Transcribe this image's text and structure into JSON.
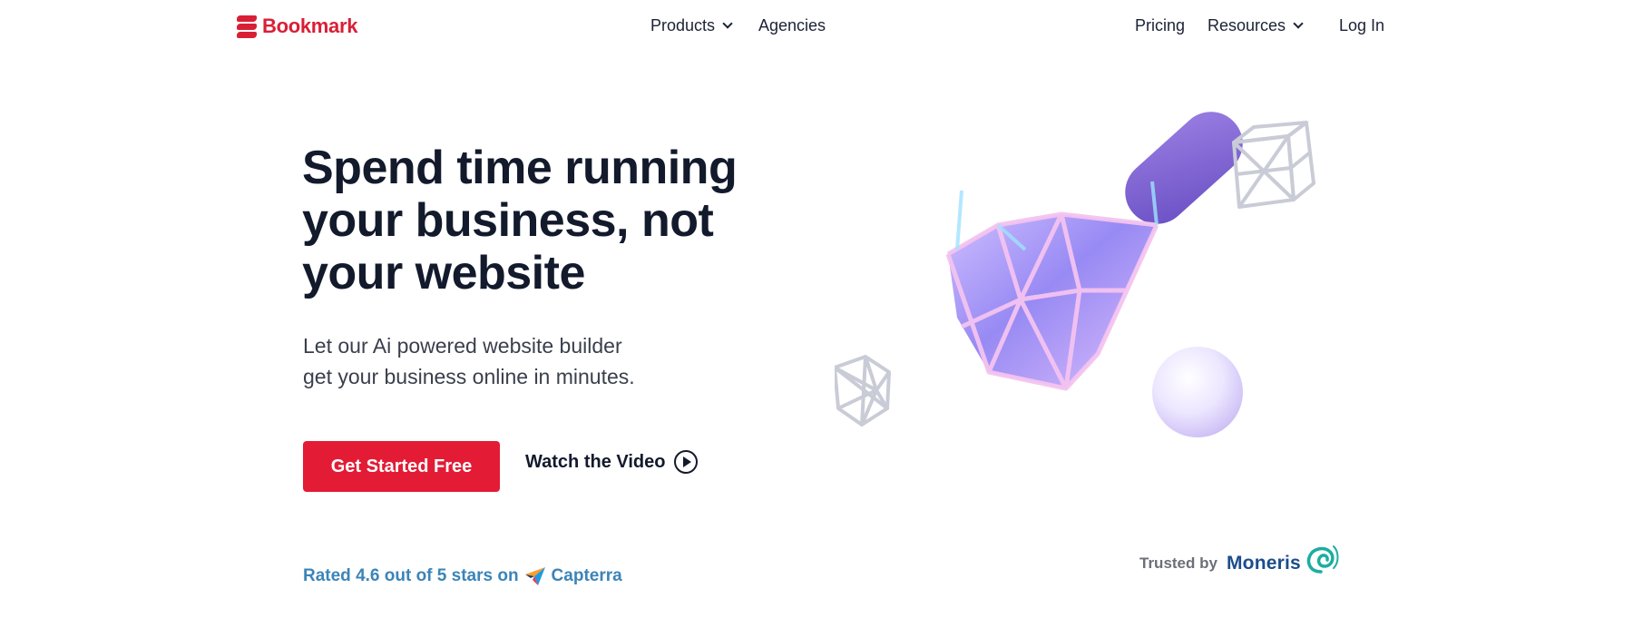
{
  "brand": {
    "name": "Bookmark",
    "color": "#d91f36"
  },
  "nav": {
    "products": "Products",
    "agencies": "Agencies",
    "pricing": "Pricing",
    "resources": "Resources",
    "login": "Log In"
  },
  "hero": {
    "headline_line1": "Spend time running",
    "headline_line2": "your business, not",
    "headline_line3": "your website",
    "sub_line1": "Let our Ai powered website builder",
    "sub_line2": "get your business online in minutes.",
    "cta_primary": "Get Started Free",
    "cta_video": "Watch the Video"
  },
  "rating": {
    "text": "Rated 4.6 out of 5 stars on",
    "platform": "Capterra"
  },
  "trusted": {
    "label": "Trusted by",
    "partner": "Moneris"
  },
  "colors": {
    "accent_red": "#e31b34",
    "rating_blue": "#3b84b8",
    "heading": "#121a2c",
    "purple": "#7e63cf"
  },
  "icons": {
    "logo": "bookmark-logo-icon",
    "dropdown": "chevron-down-icon",
    "play": "play-circle-icon",
    "capterra": "capterra-arrow-icon",
    "moneris": "moneris-swirl-icon"
  }
}
